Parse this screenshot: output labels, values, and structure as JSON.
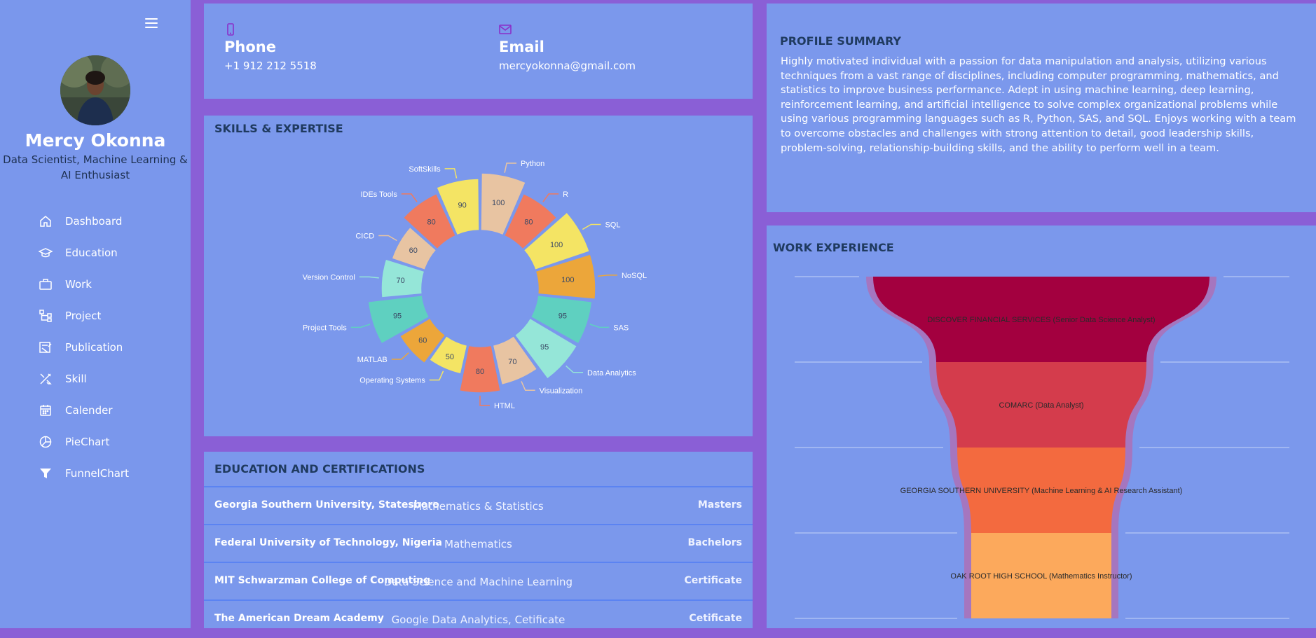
{
  "sidebar": {
    "name": "Mercy Okonna",
    "title": "Data Scientist, Machine Learning & AI Enthusiast",
    "nav": [
      {
        "label": "Dashboard",
        "icon": "home-icon"
      },
      {
        "label": "Education",
        "icon": "graduation-cap-icon"
      },
      {
        "label": "Work",
        "icon": "briefcase-icon"
      },
      {
        "label": "Project",
        "icon": "project-tree-icon"
      },
      {
        "label": "Publication",
        "icon": "publication-icon"
      },
      {
        "label": "Skill",
        "icon": "tools-icon"
      },
      {
        "label": "Calender",
        "icon": "calendar-icon"
      },
      {
        "label": "PieChart",
        "icon": "pie-chart-icon"
      },
      {
        "label": "FunnelChart",
        "icon": "funnel-icon"
      }
    ]
  },
  "contact": {
    "phone_label": "Phone",
    "phone_value": "+1 912 212 5518",
    "email_label": "Email",
    "email_value": "mercyokonna@gmail.com"
  },
  "skills": {
    "title": "SKILLS & EXPERTISE"
  },
  "education": {
    "title": "EDUCATION AND CERTIFICATIONS",
    "rows": [
      {
        "school": "Georgia Southern University, Statesboro",
        "field": "Mathematics & Statistics",
        "degree": "Masters"
      },
      {
        "school": "Federal University of Technology, Nigeria",
        "field": "Mathematics",
        "degree": "Bachelors"
      },
      {
        "school": "MIT Schwarzman College of Computing",
        "field": "Data Science and Machine Learning",
        "degree": "Certificate"
      },
      {
        "school": "The American Dream Academy",
        "field": "Google Data Analytics, Cetificate",
        "degree": "Cetificate"
      }
    ]
  },
  "profile": {
    "title": "PROFILE SUMMARY",
    "text": "Highly motivated individual with a passion for data manipulation and analysis, utilizing various techniques from a vast range of disciplines, including computer programming, mathematics, and statistics to improve business performance. Adept in using machine learning, deep learning, reinforcement learning, and artificial intelligence to solve complex organizational problems while using various programming languages such as R, Python, SAS, and SQL. Enjoys working with a team to overcome obstacles and challenges with strong attention to detail, good leadership skills, problem-solving, relationship-building skills, and the ability to perform well in a team."
  },
  "work": {
    "title": "WORK EXPERIENCE"
  },
  "colors": {
    "background": "#8a5fd6",
    "panel": "#7b98ec",
    "heading": "#1f3a5f"
  },
  "chart_data": [
    {
      "type": "pie",
      "variant": "doughnut",
      "categories": [
        "Python",
        "R",
        "SQL",
        "NoSQL",
        "SAS",
        "Data Analytics",
        "Visualization",
        "HTML",
        "Operating Systems",
        "MATLAB",
        "Project Tools",
        "Version Control",
        "CICD",
        "IDEs Tools",
        "SoftSkills"
      ],
      "values": [
        100,
        80,
        100,
        100,
        95,
        95,
        70,
        80,
        50,
        60,
        95,
        70,
        60,
        80,
        90
      ],
      "colors": [
        "#e8c4a2",
        "#f07a5e",
        "#f4e464",
        "#eca63a",
        "#5fd0c0",
        "#95e6d8",
        "#e8c4a2",
        "#f07a5e",
        "#f4e464",
        "#eca63a",
        "#5fd0c0",
        "#95e6d8",
        "#e8c4a2",
        "#f07a5e",
        "#f4e464"
      ]
    },
    {
      "type": "funnel",
      "stages": [
        {
          "label": "DISCOVER FINANCIAL SERVICES (Senior Data Science Analyst)",
          "color": "#a3003f"
        },
        {
          "label": "COMARC (Data Analyst)",
          "color": "#d43c4c"
        },
        {
          "label": "GEORGIA SOUTHERN UNIVERSITY (Machine Learning & AI Research Assistant)",
          "color": "#f36a3f"
        },
        {
          "label": "OAK ROOT HIGH SCHOOL (Mathematics Instructor)",
          "color": "#fca95c"
        }
      ]
    }
  ]
}
